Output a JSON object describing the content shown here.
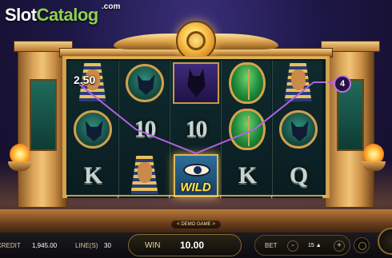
{
  "logo": {
    "part1": "Slot",
    "part2": "Catalog",
    "suffix": ".com"
  },
  "reels": [
    [
      {
        "type": "pharaoh-gold-letter",
        "label": ""
      },
      {
        "type": "cat-round",
        "label": ""
      },
      {
        "type": "letter",
        "label": "K"
      }
    ],
    [
      {
        "type": "cat-round",
        "label": ""
      },
      {
        "type": "letter",
        "label": "10"
      },
      {
        "type": "pharaoh",
        "label": ""
      }
    ],
    [
      {
        "type": "anubis",
        "label": ""
      },
      {
        "type": "letter",
        "label": "10"
      },
      {
        "type": "wild",
        "label": "WILD"
      }
    ],
    [
      {
        "type": "scarab",
        "label": ""
      },
      {
        "type": "scarab",
        "label": ""
      },
      {
        "type": "letter",
        "label": "K"
      }
    ],
    [
      {
        "type": "pharaoh",
        "label": ""
      },
      {
        "type": "cat-round",
        "label": ""
      },
      {
        "type": "letter",
        "label": "Q"
      }
    ]
  ],
  "win_display": {
    "amount": "2.50",
    "payline_number": "4"
  },
  "demo_label": "< DEMO GAME >",
  "bottom_bar": {
    "credit_label": "CREDIT",
    "credit_value": "1,945.00",
    "lines_label": "LINE(S)",
    "lines_value": "30",
    "win_label": "WIN",
    "win_value": "10.00",
    "bet_label": "BET",
    "bet_minus": "-",
    "bet_value": "15 ▲",
    "bet_plus": "+"
  },
  "colors": {
    "payline": "#b560e0",
    "frame_gold": "#d9a04a",
    "wild_text": "#ffe04a",
    "logo_green": "#8fd14f"
  }
}
